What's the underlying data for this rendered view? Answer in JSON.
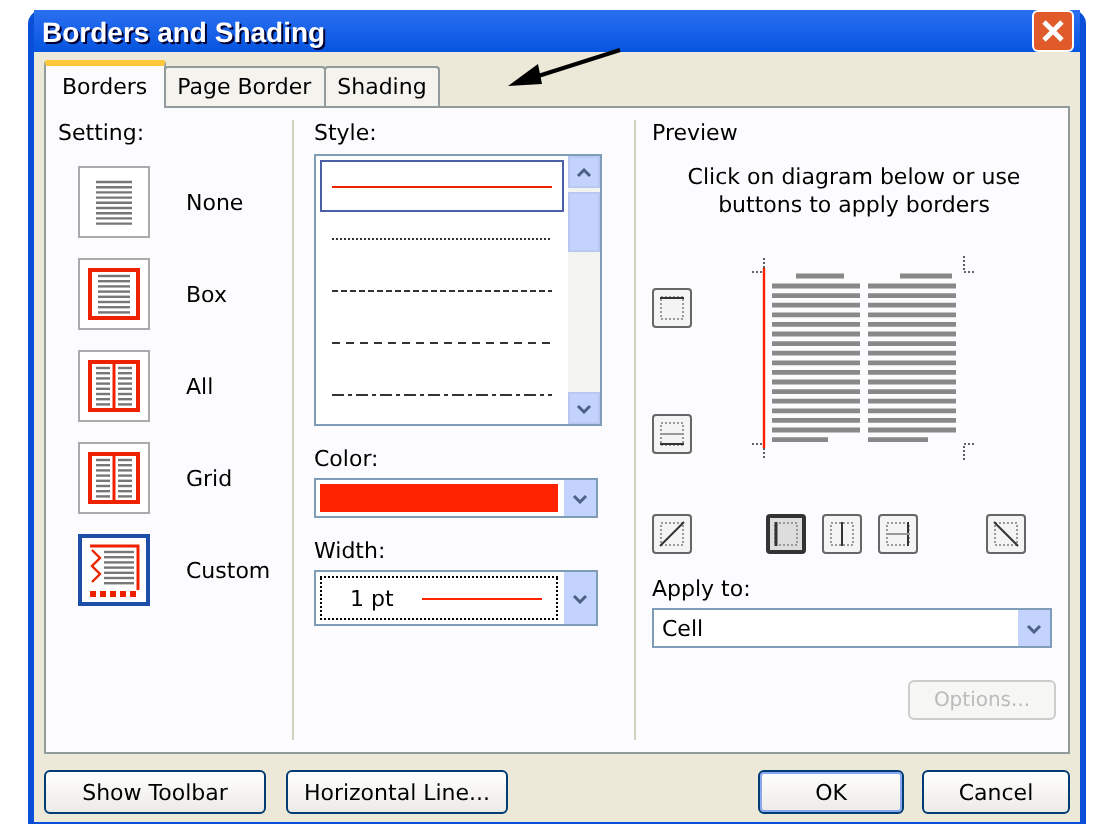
{
  "window": {
    "title": "Borders and Shading"
  },
  "tabs": [
    {
      "label": "Borders",
      "selected": true
    },
    {
      "label": "Page Border",
      "selected": false
    },
    {
      "label": "Shading",
      "selected": false
    }
  ],
  "setting": {
    "label": "Setting:",
    "items": [
      {
        "label": "None",
        "kind": "none",
        "selected": false
      },
      {
        "label": "Box",
        "kind": "box",
        "selected": false
      },
      {
        "label": "All",
        "kind": "all",
        "selected": false
      },
      {
        "label": "Grid",
        "kind": "grid",
        "selected": false
      },
      {
        "label": "Custom",
        "kind": "custom",
        "selected": true
      }
    ]
  },
  "style": {
    "label": "Style:",
    "items": [
      {
        "kind": "solid",
        "selected": true
      },
      {
        "kind": "dotted",
        "selected": false
      },
      {
        "kind": "fine-dashed",
        "selected": false
      },
      {
        "kind": "dashed",
        "selected": false
      },
      {
        "kind": "dash-dot",
        "selected": false
      }
    ]
  },
  "color": {
    "label": "Color:",
    "color": "#ff2200"
  },
  "width": {
    "label": "Width:",
    "value": "1 pt"
  },
  "preview": {
    "label": "Preview",
    "instructions": "Click on diagram below or use buttons to apply borders",
    "buttons": [
      {
        "kind": "top",
        "selected": false
      },
      {
        "kind": "bottom",
        "selected": false
      },
      {
        "kind": "diag-up",
        "selected": false
      },
      {
        "kind": "left",
        "selected": true
      },
      {
        "kind": "center",
        "selected": false
      },
      {
        "kind": "right",
        "selected": false
      },
      {
        "kind": "diag-down",
        "selected": false
      }
    ]
  },
  "apply_to": {
    "label": "Apply to:",
    "value": "Cell"
  },
  "options_button": {
    "label": "Options...",
    "disabled": true
  },
  "footer_buttons": [
    "Show Toolbar",
    "Horizontal Line...",
    "OK",
    "Cancel"
  ]
}
